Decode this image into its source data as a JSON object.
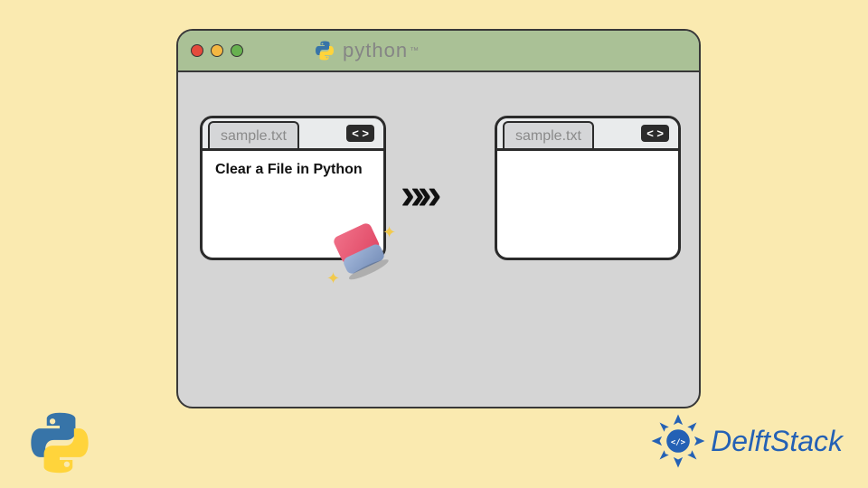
{
  "window": {
    "title_text": "python"
  },
  "left_panel": {
    "tab_label": "sample.txt",
    "corner_symbol": "< >",
    "content": "Clear a File in Python"
  },
  "right_panel": {
    "tab_label": "sample.txt",
    "corner_symbol": "< >",
    "content": ""
  },
  "arrow_symbol": "»»",
  "brand": {
    "name": "DelftStack"
  }
}
